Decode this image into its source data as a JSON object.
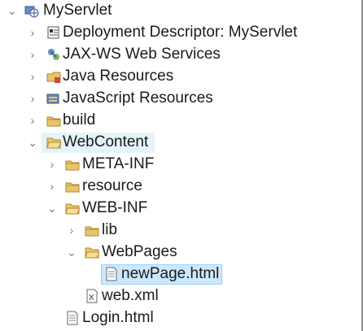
{
  "tree": {
    "project": "MyServlet",
    "deployment_descriptor": "Deployment Descriptor: MyServlet",
    "jaxws": "JAX-WS Web Services",
    "java_resources": "Java Resources",
    "javascript_resources": "JavaScript Resources",
    "build": "build",
    "webcontent": "WebContent",
    "meta_inf": "META-INF",
    "resource": "resource",
    "web_inf": "WEB-INF",
    "lib": "lib",
    "webpages": "WebPages",
    "newpage": "newPage.html",
    "webxml": "web.xml",
    "login": "Login.html"
  },
  "icons": {
    "project": "web-project-icon",
    "deployment_descriptor": "deployment-descriptor-icon",
    "jaxws": "web-services-icon",
    "java_resources": "java-resources-icon",
    "javascript_resources": "javascript-resources-icon",
    "folder": "folder-icon",
    "html_file": "html-file-icon",
    "xml_file": "xml-file-icon"
  },
  "colors": {
    "selection": "#cce8ff",
    "hover": "#e5f3fb",
    "folder": "#e8c46a"
  }
}
